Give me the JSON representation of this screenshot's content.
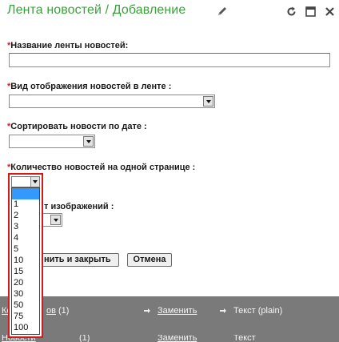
{
  "header": {
    "title": "Лента новостей / Добавление",
    "icons": [
      "pencil-icon",
      "refresh-icon",
      "maximize-icon",
      "close-icon"
    ]
  },
  "form": {
    "required_mark": "*",
    "name_label": "Название ленты новостей:",
    "name_value": "",
    "display_label": "Вид отображения новостей в ленте :",
    "display_value": "",
    "sort_label": "Сортировать новости по дате :",
    "sort_value": "",
    "count_label": "Количество новостей на одной странице :",
    "count_value": "",
    "images_label_partial": "т изображений :",
    "images_value": "",
    "save_close_label": "нить и закрыть",
    "cancel_label": "Отмена"
  },
  "dropdown": {
    "options": [
      "",
      "1",
      "2",
      "3",
      "4",
      "5",
      "10",
      "15",
      "20",
      "30",
      "50",
      "75",
      "100"
    ],
    "selected_index": 0
  },
  "footer": {
    "row1": {
      "link_left_a": "Ко",
      "link_left_b": "ов",
      "count": "(1)",
      "replace": "Заменить",
      "type": "Текст (plain)"
    },
    "row2": {
      "link_left": "Новости",
      "count": "(1)",
      "replace": "Заменить",
      "type": "Текст"
    }
  },
  "colors": {
    "title_green": "#3aa13a",
    "required_red": "#cc2222",
    "highlight_red": "#d21a1a",
    "selection_blue": "#3399ff",
    "footer_gray": "#7a7a7a"
  }
}
